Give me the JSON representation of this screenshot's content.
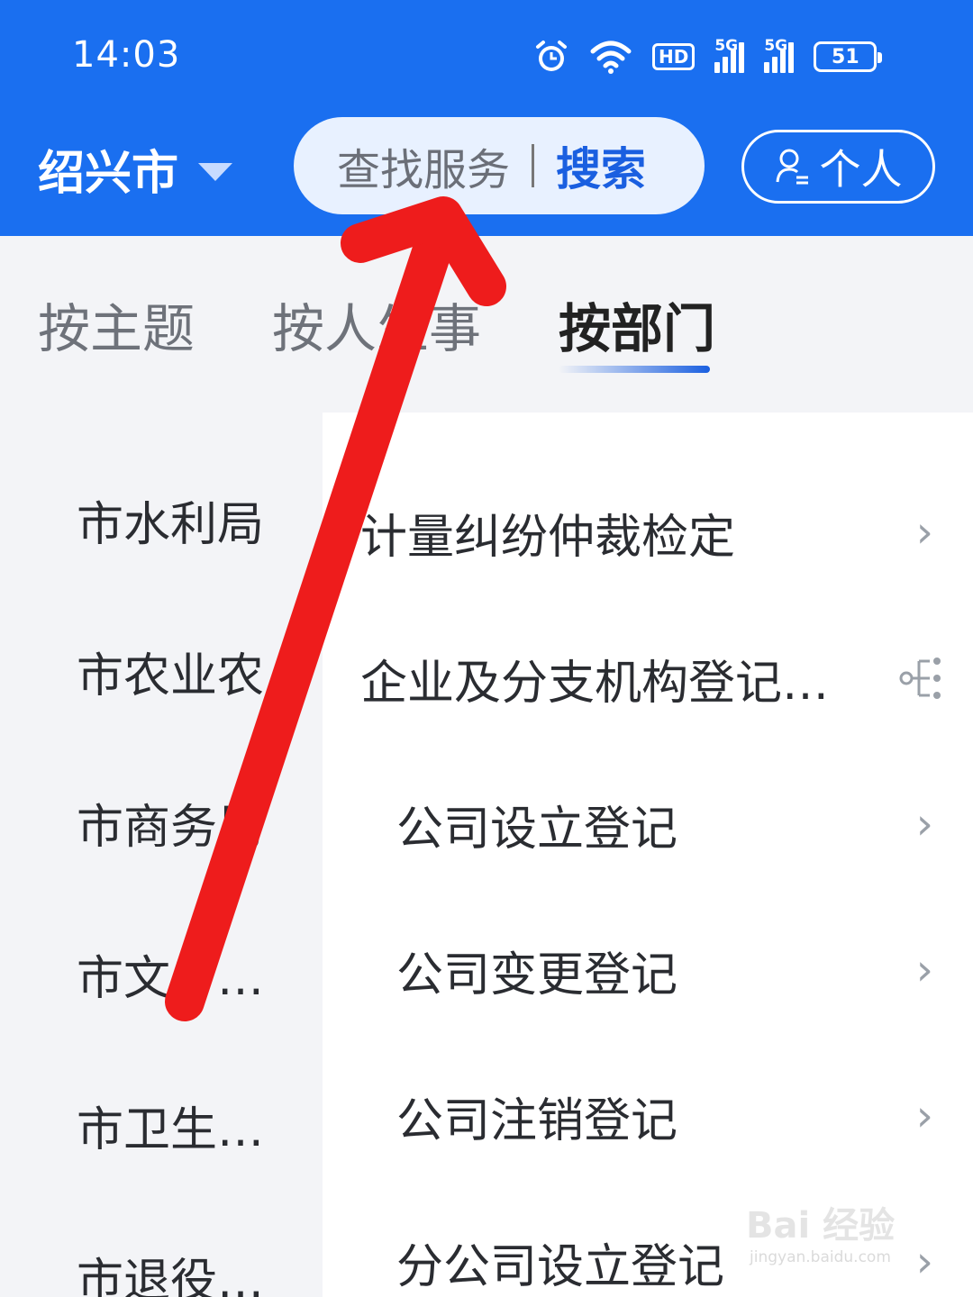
{
  "status_bar": {
    "time": "14:03",
    "icons": [
      "alarm-icon",
      "wifi-icon",
      "hd-icon",
      "5g-signal-icon",
      "5g-signal-icon",
      "battery-icon"
    ],
    "hd_label": "HD",
    "fiveg_label": "5G",
    "battery_level": "51"
  },
  "header": {
    "city": "绍兴市",
    "search_placeholder": "查找服务",
    "search_button": "搜索",
    "personal_button": "个人",
    "bg_color": "#1a6ff0"
  },
  "tabs": [
    {
      "label": "按主题",
      "active": false
    },
    {
      "label": "按人生事",
      "active": false
    },
    {
      "label": "按部门",
      "active": true
    }
  ],
  "departments": [
    "市水利局",
    "市农业农",
    "市商务局",
    "市文广旅…",
    "市卫生健…",
    "市退役军…"
  ],
  "services": [
    {
      "label": "计量纠纷仲裁检定",
      "level": 1,
      "trailing": "chevron-right-icon"
    },
    {
      "label": "企业及分支机构登记…",
      "level": 1,
      "trailing": "tree-icon"
    },
    {
      "label": "公司设立登记",
      "level": 2,
      "trailing": "chevron-right-icon"
    },
    {
      "label": "公司变更登记",
      "level": 2,
      "trailing": "chevron-right-icon"
    },
    {
      "label": "公司注销登记",
      "level": 2,
      "trailing": "chevron-right-icon"
    },
    {
      "label": "分公司设立登记",
      "level": 2,
      "trailing": "chevron-right-icon"
    }
  ],
  "chevron_glyph": "›",
  "overlay": {
    "arrow_color": "#ee1c1c"
  },
  "watermark": {
    "brand": "Bai 经验",
    "url": "jingyan.baidu.com"
  }
}
